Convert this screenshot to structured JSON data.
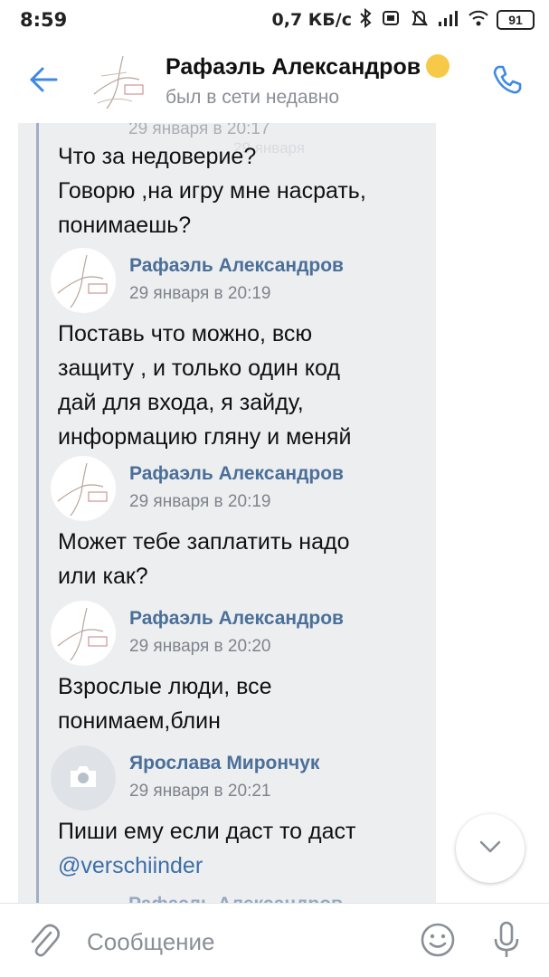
{
  "status_bar": {
    "time": "8:59",
    "net_speed": "0,7 КБ/с",
    "battery": "91"
  },
  "header": {
    "name": "Рафаэль Александров",
    "status": "был в сети недавно",
    "emoji": "nerd-face-emoji"
  },
  "chat": {
    "ghost_date": "29 января",
    "faded_top_date": "29 января в 20:17",
    "messages": [
      {
        "text_lines": [
          "Что за недоверие?",
          "Говорю ,на игру мне насрать,",
          "понимаешь?"
        ]
      },
      {
        "author": "Рафаэль Александров",
        "date": "29 января в 20:19",
        "text_lines": [
          "Поставь что можно, всю",
          "защиту , и только один код",
          "дай для входа, я зайду,",
          "информацию гляну и меняй"
        ]
      },
      {
        "author": "Рафаэль Александров",
        "date": "29 января в 20:19",
        "text_lines": [
          "Может тебе заплатить надо",
          "или как?"
        ]
      },
      {
        "author": "Рафаэль Александров",
        "date": "29 января в 20:20",
        "text_lines": [
          "Взрослые люди, все",
          "понимаем,блин"
        ]
      },
      {
        "author": "Ярослава Мирончук",
        "date": "29 января в 20:21",
        "text_lines": [
          "Пиши ему если даст то даст"
        ],
        "mention": "@verschiinder"
      }
    ],
    "faded_bottom_author": "Рафаэль Александров"
  },
  "composer": {
    "placeholder": "Сообщение"
  },
  "colors": {
    "accent": "#3f8ae0",
    "author": "#4a6f99",
    "quote_bg": "#edeef0",
    "quote_line": "#9fb0c5"
  }
}
